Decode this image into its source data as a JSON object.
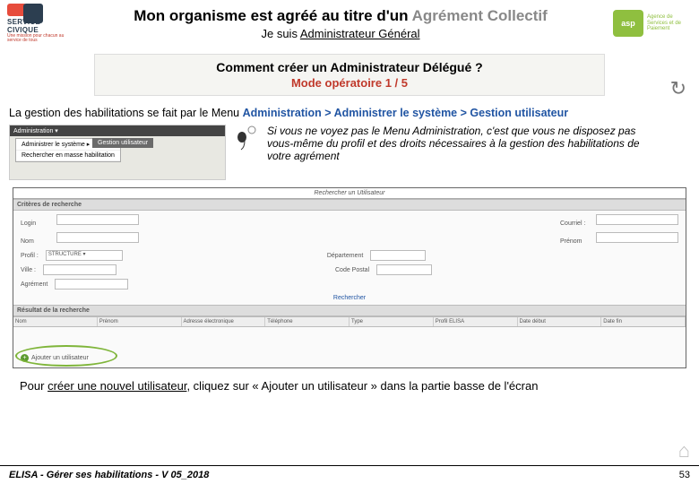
{
  "header": {
    "logo_left_line1": "SERVICE",
    "logo_left_line2": "CIVIQUE",
    "logo_left_tag": "Une mission pour chacun au service de tous",
    "title_black": "Mon organisme est agréé au titre d'un ",
    "title_grey": "Agrément Collectif",
    "subtitle_prefix": "Je suis ",
    "subtitle_role": "Administrateur Général",
    "asp_abbr": "asp",
    "asp_text": "Agence de Services et de Paiement"
  },
  "question": {
    "q": "Comment créer un Administrateur Délégué ?",
    "mode": "Mode opératoire 1 / 5"
  },
  "path_line": {
    "prefix": "La gestion des habilitations se fait par le Menu ",
    "p1": "Administration",
    "sep1": " > ",
    "p2": "Administrer le système",
    "sep2": " > ",
    "p3": "Gestion utilisateur"
  },
  "menu_mock": {
    "bar": "Administration ▾",
    "item1": "Administrer le système ▸",
    "item2": "Rechercher en masse habilitation",
    "sub": "Gestion utilisateur"
  },
  "tip": "Si vous ne voyez pas le Menu Administration, c'est que vous ne disposez pas vous-même du profil et des droits nécessaires à la gestion des habilitations de votre agrément",
  "sb": {
    "title": "Rechercher un Utilisateur",
    "sec1": "Critères de recherche",
    "login": "Login",
    "nom": "Nom",
    "courriel": "Courriel :",
    "prenom": "Prénom",
    "profil": "Profil :",
    "profil_val": "STRUCTURE ▾",
    "ville": "Ville :",
    "departement": "Département",
    "codepostal": "Code Postal",
    "agrement": "Agrément",
    "search": "Rechercher",
    "sec2": "Résultat de la recherche",
    "th": [
      "Nom",
      "Prénom",
      "Adresse électronique",
      "Téléphone",
      "Type",
      "Profil ELISA",
      "Date début",
      "Date fin"
    ],
    "add": "Ajouter un utilisateur"
  },
  "instruction": {
    "p1": "Pour ",
    "u": "créer une nouvel utilisateur",
    "p2": ", cliquez sur « Ajouter un utilisateur » dans la partie basse de l'écran"
  },
  "footer": {
    "left": "ELISA - Gérer ses habilitations - V 05_2018",
    "page": "53"
  }
}
